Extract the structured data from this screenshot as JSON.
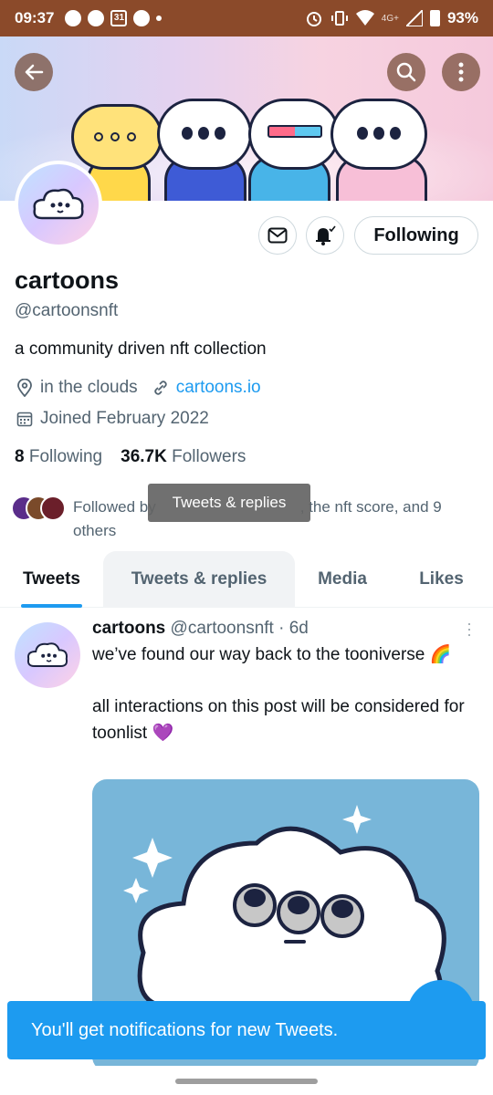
{
  "status_bar": {
    "time": "09:37",
    "calendar_day": "31",
    "network": "4G+",
    "battery": "93%"
  },
  "profile": {
    "name": "cartoons",
    "handle": "@cartoonsnft",
    "bio": "a community driven nft collection",
    "location": "in the clouds",
    "website": "cartoons.io",
    "joined": "Joined February 2022",
    "following_count": "8",
    "following_label": "Following",
    "followers_count": "36.7K",
    "followers_label": "Followers",
    "follow_button": "Following",
    "followed_by_start": "Followed by",
    "followed_by_end": ", the nft score, and 9 others"
  },
  "tooltip": "Tweets & replies",
  "tabs": [
    {
      "label": "Tweets"
    },
    {
      "label": "Tweets & replies"
    },
    {
      "label": "Media"
    },
    {
      "label": "Likes"
    }
  ],
  "tweet": {
    "author_name": "cartoons",
    "author_handle": "@cartoonsnft",
    "time": "· 6d",
    "text": "we’ve found our way back to the tooniverse 🌈\n\nall interactions on this post will be considered for toonlist 💜"
  },
  "toast": "You'll get notifications for new Tweets.",
  "colors": {
    "accent": "#1d9bf0",
    "status_bar": "#8b4a2a"
  }
}
